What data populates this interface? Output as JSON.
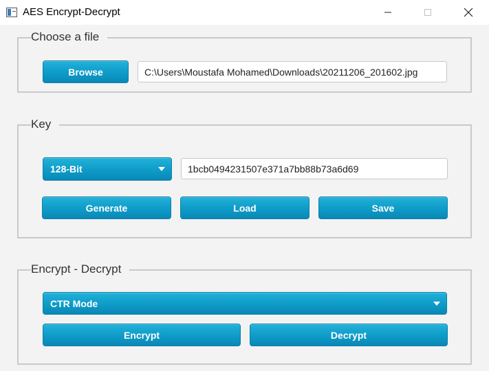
{
  "window": {
    "title": "AES Encrypt-Decrypt",
    "controls": [
      "minimize-icon",
      "maximize-icon",
      "close-icon"
    ]
  },
  "file_group": {
    "title": "Choose a file",
    "browse_label": "Browse",
    "path_value": "C:\\Users\\Moustafa Mohamed\\Downloads\\20211206_201602.jpg"
  },
  "key_group": {
    "title": "Key",
    "key_size_selected": "128-Bit",
    "key_value": "1bcb0494231507e371a7bb88b73a6d69",
    "generate_label": "Generate",
    "load_label": "Load",
    "save_label": "Save"
  },
  "crypt_group": {
    "title": "Encrypt - Decrypt",
    "mode_selected": "CTR Mode",
    "encrypt_label": "Encrypt",
    "decrypt_label": "Decrypt"
  },
  "colors": {
    "accent": "#0e9bc8",
    "background": "#f3f3f3",
    "group_border": "#c9c9c9"
  }
}
